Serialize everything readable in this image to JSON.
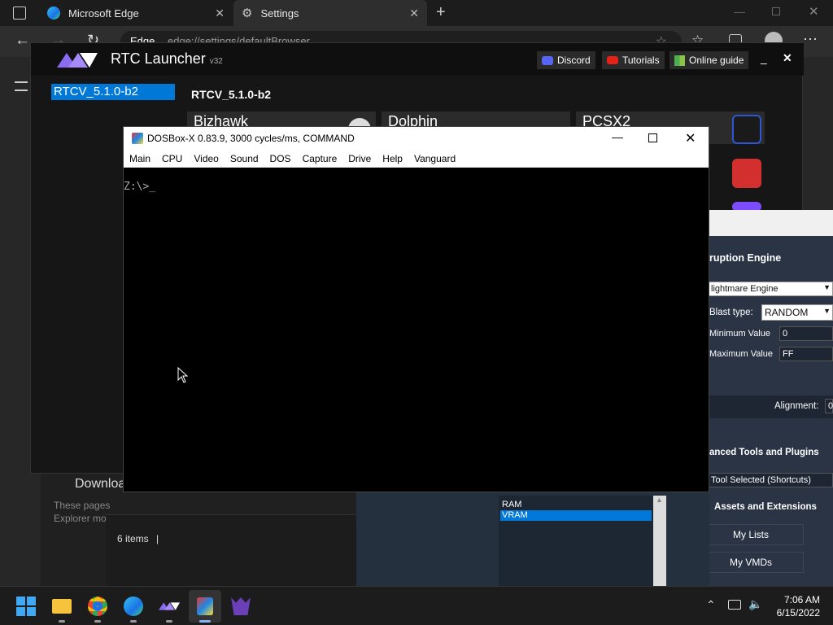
{
  "edge": {
    "tabs": [
      {
        "label": "Microsoft Edge"
      },
      {
        "label": "Settings"
      }
    ],
    "address_prefix": "Edge",
    "address": "edge://settings/defaultBrowser",
    "download_text": "Downloa",
    "notice_lines": [
      "These pages",
      "Explorer mo"
    ]
  },
  "rtc": {
    "title": "RTC Launcher",
    "version_tag": "v32",
    "buttons": {
      "discord": "Discord",
      "tutorials": "Tutorials",
      "online_guide": "Online guide"
    },
    "selected_version": "RTCV_5.1.0-b2",
    "version_heading": "RTCV_5.1.0-b2",
    "cards": [
      "Bizhawk",
      "Dolphin",
      "PCSX2"
    ]
  },
  "corruption": {
    "engine_heading": "ruption Engine",
    "engine_value": "lightmare Engine",
    "blast_type_label": "Blast type:",
    "blast_type_value": "RANDOM",
    "min_label": "Minimum Value",
    "min_value": "0",
    "max_label": "Maximum Value",
    "max_value": "FF",
    "alignment_label": "Alignment:",
    "alignment_value": "0",
    "tools_heading": "anced Tools and Plugins",
    "tool_selected": "Tool Selected (Shortcuts)",
    "assets_heading": "Assets and Extensions",
    "my_lists": "My Lists",
    "my_vmds": "My VMDs"
  },
  "memory_domains": {
    "items": [
      "RAM",
      "VRAM"
    ],
    "selected": "VRAM"
  },
  "explorer": {
    "items_count": "6 items"
  },
  "dosbox": {
    "title": "DOSBox-X 0.83.9, 3000 cycles/ms, COMMAND",
    "menu": [
      "Main",
      "CPU",
      "Video",
      "Sound",
      "DOS",
      "Capture",
      "Drive",
      "Help",
      "Vanguard"
    ],
    "prompt": "Z:\\>_"
  },
  "taskbar": {
    "time": "7:06 AM",
    "date": "6/15/2022"
  },
  "colors": {
    "accent": "#0078d7",
    "rtc_logo": "#8a6cf0"
  }
}
